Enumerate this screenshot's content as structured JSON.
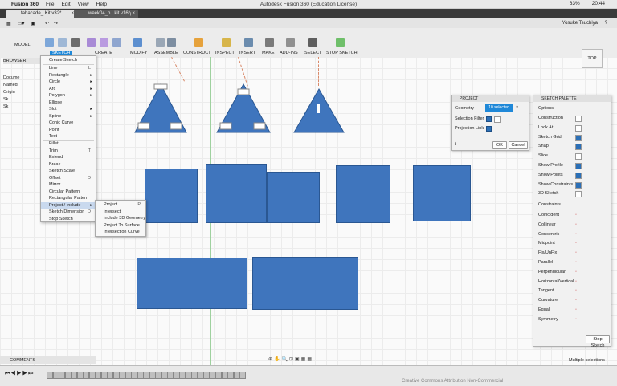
{
  "menubar": {
    "app": "Fusion 360",
    "items": [
      "File",
      "Edit",
      "View",
      "Help"
    ],
    "window_title": "Autodesk Fusion 360 (Education License)",
    "battery": "63%",
    "time": "20:44"
  },
  "tabs": [
    {
      "label": "fabacade_ Kit v32*"
    },
    {
      "label": "week04_p...kit v16*"
    }
  ],
  "qat": {
    "user": "Yosuke Tsuchiya",
    "help": "?"
  },
  "ribbon": {
    "workspace": "MODEL",
    "groups": [
      "SKETCH",
      "CREATE",
      "MODIFY",
      "ASSEMBLE",
      "CONSTRUCT",
      "INSPECT",
      "INSERT",
      "MAKE",
      "ADD-INS",
      "SELECT",
      "STOP SKETCH"
    ]
  },
  "browser": {
    "title": "BROWSER",
    "rows": [
      "Docume",
      "Named",
      "Origin",
      "Sk",
      "Sk"
    ]
  },
  "sketch_menu": {
    "items": [
      {
        "label": "Create Sketch",
        "sc": ""
      },
      {
        "label": "Line",
        "sc": "L"
      },
      {
        "label": "Rectangle",
        "sc": "",
        "sub": true
      },
      {
        "label": "Circle",
        "sc": "",
        "sub": true
      },
      {
        "label": "Arc",
        "sc": "",
        "sub": true
      },
      {
        "label": "Polygon",
        "sc": "",
        "sub": true
      },
      {
        "label": "Ellipse",
        "sc": ""
      },
      {
        "label": "Slot",
        "sc": "",
        "sub": true
      },
      {
        "label": "Spline",
        "sc": "",
        "sub": true
      },
      {
        "label": "Conic Curve",
        "sc": ""
      },
      {
        "label": "Point",
        "sc": ""
      },
      {
        "label": "Text",
        "sc": ""
      },
      {
        "label": "Fillet",
        "sc": ""
      },
      {
        "label": "Trim",
        "sc": "T"
      },
      {
        "label": "Extend",
        "sc": ""
      },
      {
        "label": "Break",
        "sc": ""
      },
      {
        "label": "Sketch Scale",
        "sc": ""
      },
      {
        "label": "Offset",
        "sc": "O"
      },
      {
        "label": "Mirror",
        "sc": ""
      },
      {
        "label": "Circular Pattern",
        "sc": ""
      },
      {
        "label": "Rectangular Pattern",
        "sc": ""
      },
      {
        "label": "Project / Include",
        "sc": "",
        "sub": true
      },
      {
        "label": "Sketch Dimension",
        "sc": "D"
      },
      {
        "label": "Stop Sketch",
        "sc": ""
      }
    ]
  },
  "project_submenu": {
    "items": [
      {
        "label": "Project",
        "sc": "P"
      },
      {
        "label": "Intersect",
        "sc": ""
      },
      {
        "label": "Include 3D Geometry",
        "sc": ""
      },
      {
        "label": "Project To Surface",
        "sc": ""
      },
      {
        "label": "Intersection Curve",
        "sc": ""
      }
    ]
  },
  "project_dialog": {
    "title": "PROJECT",
    "geometry_label": "Geometry",
    "geometry_value": "10 selected",
    "selection_filter_label": "Selection Filter",
    "projection_link_label": "Projection Link",
    "ok": "OK",
    "cancel": "Cancel"
  },
  "sketch_palette": {
    "title": "SKETCH PALETTE",
    "options_title": "Options",
    "options": [
      {
        "label": "Construction",
        "checked": false
      },
      {
        "label": "Look At",
        "checked": false
      },
      {
        "label": "Sketch Grid",
        "checked": true
      },
      {
        "label": "Snap",
        "checked": true
      },
      {
        "label": "Slice",
        "checked": false
      },
      {
        "label": "Show Profile",
        "checked": true
      },
      {
        "label": "Show Points",
        "checked": true
      },
      {
        "label": "Show Constraints",
        "checked": true
      },
      {
        "label": "3D Sketch",
        "checked": false
      }
    ],
    "constraints_title": "Constraints",
    "constraints": [
      "Coincident",
      "Collinear",
      "Concentric",
      "Midpoint",
      "Fix/UnFix",
      "Parallel",
      "Perpendicular",
      "Horizontal/Vertical",
      "Tangent",
      "Curvature",
      "Equal",
      "Symmetry"
    ],
    "stop_button": "Stop Sketch"
  },
  "viewcube": {
    "label": "TOP"
  },
  "status": {
    "comments": "COMMENTS",
    "selection": "Multiple selections",
    "watermark": "Creative Commons Attribution Non-Commercial"
  },
  "colors": {
    "accent": "#3f75bd",
    "select_highlight": "#1f88d8"
  }
}
